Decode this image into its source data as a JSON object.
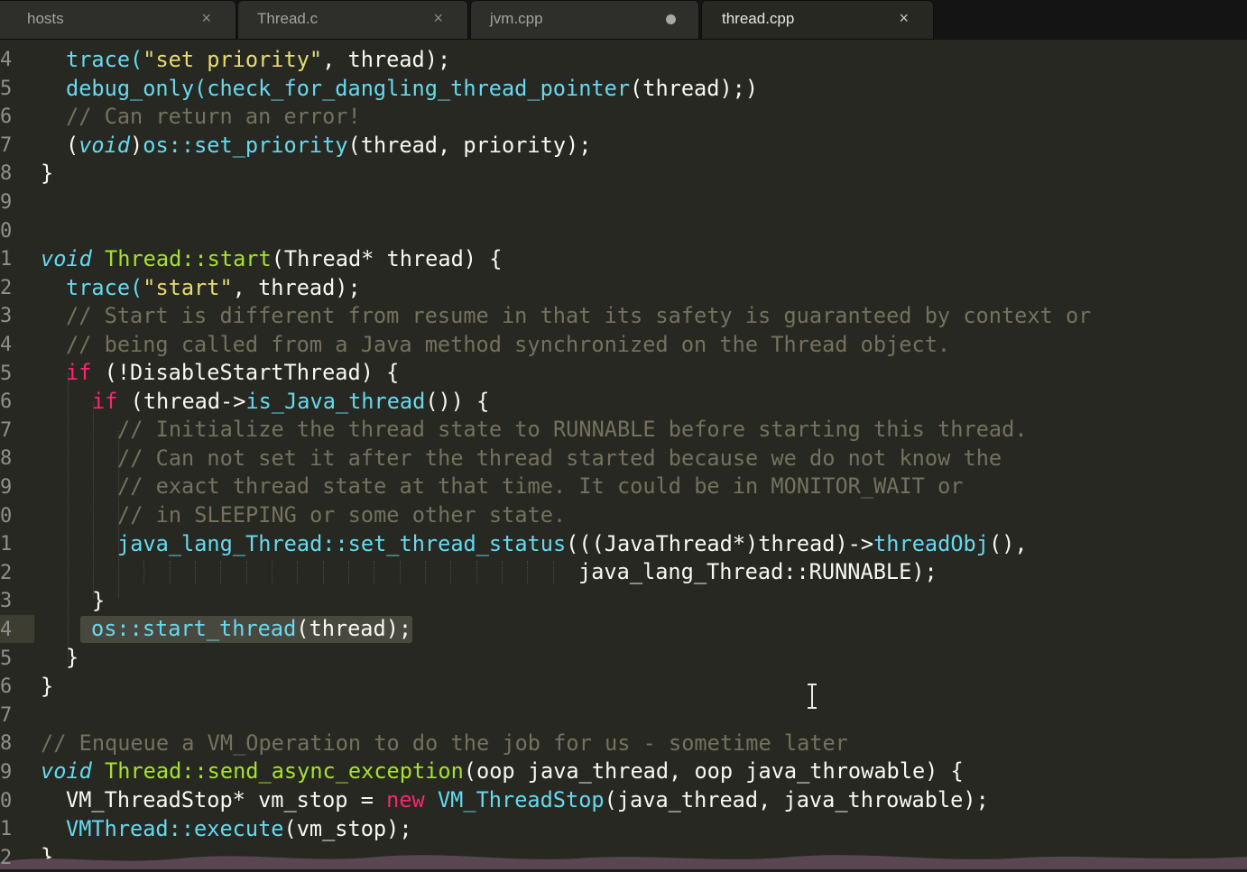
{
  "tabs": [
    {
      "label": "hosts",
      "close": "×",
      "active": false
    },
    {
      "label": "Thread.c",
      "close": "×",
      "active": false
    },
    {
      "label": "jvm.cpp",
      "close": "",
      "active": false,
      "modified": true
    },
    {
      "label": "thread.cpp",
      "close": "×",
      "active": true
    }
  ],
  "line_numbers": [
    "4",
    "5",
    "6",
    "7",
    "8",
    "9",
    "0",
    "1",
    "2",
    "3",
    "4",
    "5",
    "6",
    "7",
    "8",
    "9",
    "0",
    "1",
    "2",
    "3",
    "4",
    "5",
    "6",
    "7",
    "8",
    "9",
    "0",
    "1",
    "2"
  ],
  "code": {
    "l0": {
      "a": "trace(",
      "b": "\"set priority\"",
      "c": ", thread);"
    },
    "l1": {
      "a": "debug_only(",
      "b": "check_for_dangling_thread_pointer",
      "c": "(thread);)"
    },
    "l2": {
      "a": "// Can return an error!"
    },
    "l3": {
      "a": "(",
      "b": "void",
      "c": ")",
      "d": "os::set_priority",
      "e": "(thread, priority);"
    },
    "l4": {
      "a": "}"
    },
    "l7": {
      "a": "void",
      "b": " ",
      "c": "Thread::start",
      "d": "(Thread* thread) {"
    },
    "l8": {
      "a": "trace(",
      "b": "\"start\"",
      "c": ", thread);"
    },
    "l9": {
      "a": "// Start is different from resume in that its safety is guaranteed by context or"
    },
    "l10": {
      "a": "// being called from a Java method synchronized on the Thread object."
    },
    "l11": {
      "a": "if",
      "b": " (!DisableStartThread) {"
    },
    "l12": {
      "a": "if",
      "b": " (thread->",
      "c": "is_Java_thread",
      "d": "()) {"
    },
    "l13": {
      "a": "// Initialize the thread state to RUNNABLE before starting this thread."
    },
    "l14": {
      "a": "// Can not set it after the thread started because we do not know the"
    },
    "l15": {
      "a": "// exact thread state at that time. It could be in MONITOR_WAIT or"
    },
    "l16": {
      "a": "// in SLEEPING or some other state."
    },
    "l17": {
      "a": "java_lang_Thread::set_thread_status",
      "b": "(((JavaThread*)thread)->",
      "c": "threadObj",
      "d": "(),"
    },
    "l18": {
      "a": "java_lang_Thread::RUNNABLE);"
    },
    "l19": {
      "a": "}"
    },
    "l20": {
      "a": "os::start_thread",
      "b": "(thread);"
    },
    "l21": {
      "a": "}"
    },
    "l22": {
      "a": "}"
    },
    "l24": {
      "a": "// Enqueue a VM_Operation to do the job for us - sometime later"
    },
    "l25": {
      "a": "void",
      "b": " ",
      "c": "Thread::send_async_exception",
      "d": "(oop java_thread, oop java_throwable) {"
    },
    "l26": {
      "a": "VM_ThreadStop* vm_stop = ",
      "b": "new",
      "c": " ",
      "d": "VM_ThreadStop",
      "e": "(java_thread, java_throwable);"
    },
    "l27": {
      "a": "VMThread::execute",
      "b": "(vm_stop);"
    },
    "l28": {
      "a": "}"
    }
  },
  "colors": {
    "background": "#272822",
    "keyword": "#f92672",
    "storage": "#66d9ef",
    "function": "#a6e22e",
    "string": "#e6db74",
    "comment": "#75715e"
  }
}
